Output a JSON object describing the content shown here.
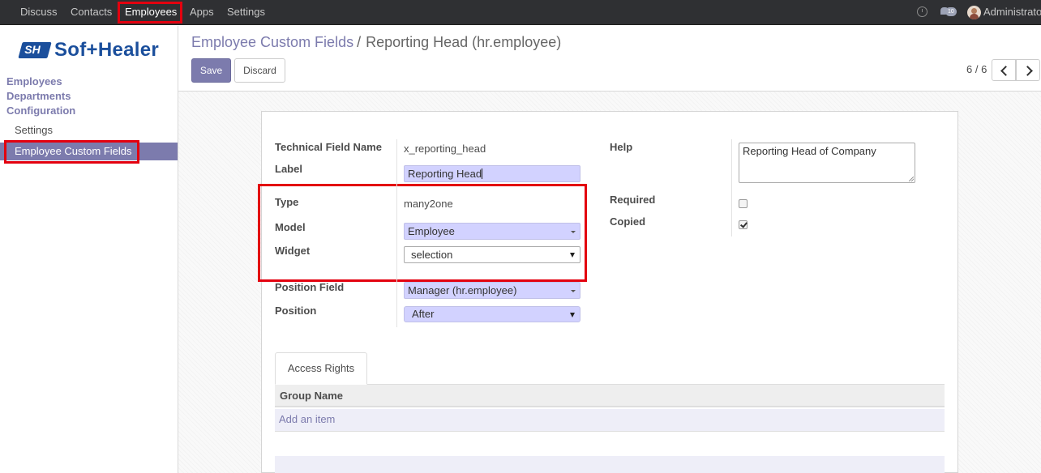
{
  "topbar": {
    "menu": [
      "Discuss",
      "Contacts",
      "Employees",
      "Apps",
      "Settings"
    ],
    "active": "Employees",
    "message_count": "10",
    "user_name": "Administrator"
  },
  "sidebar": {
    "logo": {
      "mark": "SH",
      "word": "Sof+Healer"
    },
    "sections": [
      "Employees",
      "Departments",
      "Configuration"
    ],
    "sub_items": [
      "Settings",
      "Employee Custom Fields"
    ]
  },
  "control_panel": {
    "breadcrumb_parent": "Employee Custom Fields",
    "breadcrumb_sep": "/",
    "breadcrumb_current": "Reporting Head (hr.employee)",
    "save_label": "Save",
    "discard_label": "Discard",
    "pager": "6 / 6"
  },
  "form": {
    "labels": {
      "technical_name": "Technical Field Name",
      "label": "Label",
      "type": "Type",
      "model": "Model",
      "widget": "Widget",
      "position_field": "Position Field",
      "position": "Position",
      "help": "Help",
      "required": "Required",
      "copied": "Copied"
    },
    "values": {
      "technical_name": "x_reporting_head",
      "label": "Reporting Head",
      "type": "many2one",
      "model": "Employee",
      "widget": "selection",
      "position_field": "Manager (hr.employee)",
      "position": "After",
      "help": "Reporting Head of Company",
      "required": false,
      "copied": true
    }
  },
  "tabs": {
    "access_rights": "Access Rights"
  },
  "table": {
    "column": "Group Name",
    "add_item": "Add an item"
  },
  "colors": {
    "brand": "#7c7bad",
    "highlight_red": "#e3000f",
    "navbar": "#2f3033",
    "required_field": "#d2d2ff"
  }
}
